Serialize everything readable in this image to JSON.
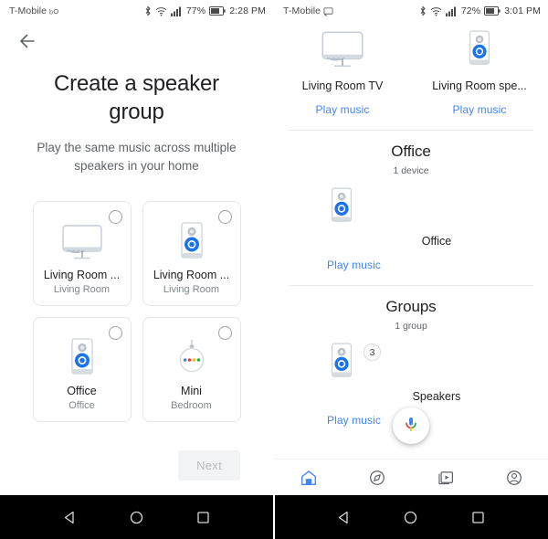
{
  "left": {
    "status": {
      "carrier": "T-Mobile",
      "icons": [
        "vowifi-icon",
        "bluetooth-icon",
        "wifi-icon",
        "signal-icon",
        "battery-icon"
      ],
      "battery": "77%",
      "time": "2:28 PM"
    },
    "back_label": "back-arrow",
    "title": "Create a speaker group",
    "subtitle": "Play the same music across multiple speakers in your home",
    "cards": [
      {
        "name": "Living Room ...",
        "room": "Living Room",
        "icon": "cast-tv-icon",
        "selected": false
      },
      {
        "name": "Living Room ...",
        "room": "Living Room",
        "icon": "smart-speaker-icon",
        "selected": false
      },
      {
        "name": "Office",
        "room": "Office",
        "icon": "smart-speaker-icon",
        "selected": false
      },
      {
        "name": "Mini",
        "room": "Bedroom",
        "icon": "mini-speaker-icon",
        "selected": false
      }
    ],
    "next_label": "Next"
  },
  "right": {
    "status": {
      "carrier": "T-Mobile",
      "icons": [
        "cast-icon",
        "bluetooth-icon",
        "wifi-icon",
        "signal-icon",
        "battery-icon"
      ],
      "battery": "72%",
      "time": "3:01 PM"
    },
    "top_devices": [
      {
        "name": "Living Room TV",
        "icon": "cast-tv-icon",
        "action": "Play music"
      },
      {
        "name": "Living Room spe...",
        "icon": "smart-speaker-icon",
        "action": "Play music"
      }
    ],
    "sections": [
      {
        "title": "Office",
        "subtitle": "1 device",
        "device": {
          "name": "Office",
          "icon": "smart-speaker-icon",
          "action": "Play music",
          "badge": ""
        }
      },
      {
        "title": "Groups",
        "subtitle": "1 group",
        "device": {
          "name": "Speakers",
          "icon": "smart-speaker-icon",
          "action": "Play music",
          "badge": "3"
        }
      }
    ],
    "fab": "assistant-mic-icon",
    "nav": [
      {
        "name": "home-icon",
        "label": "Home",
        "active": true
      },
      {
        "name": "explore-compass-icon",
        "label": "Explore",
        "active": false
      },
      {
        "name": "media-library-icon",
        "label": "Media",
        "active": false
      },
      {
        "name": "account-icon",
        "label": "Account",
        "active": false
      }
    ]
  },
  "android_nav": [
    {
      "name": "back-triangle-icon",
      "label": "Back"
    },
    {
      "name": "home-circle-icon",
      "label": "Home"
    },
    {
      "name": "recents-square-icon",
      "label": "Recents"
    }
  ],
  "colors": {
    "accent_blue": "#4285f4",
    "text_primary": "#202124",
    "text_secondary": "#5f6368",
    "divider": "#e8eaed"
  }
}
